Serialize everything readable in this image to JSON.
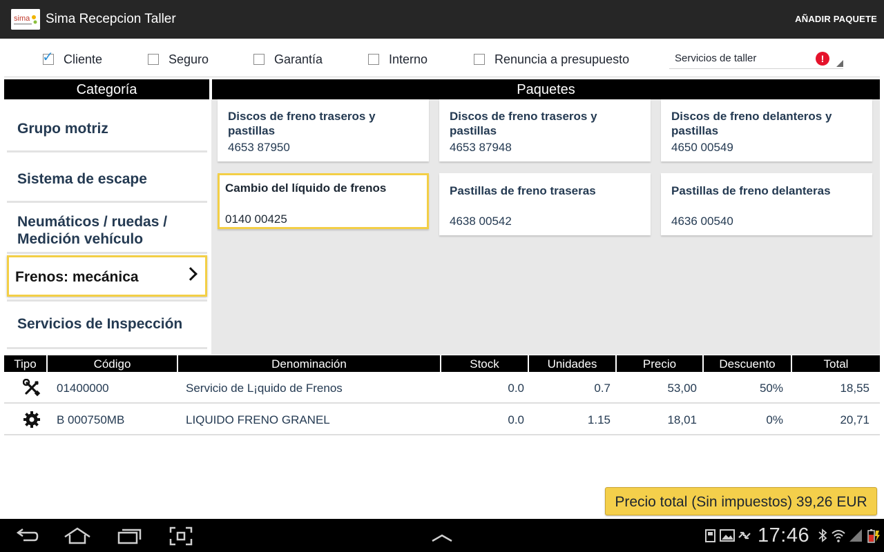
{
  "app": {
    "title": "Sima Recepcion Taller",
    "add_package_label": "AÑADIR PAQUETE"
  },
  "filters": {
    "checkboxes": [
      {
        "label": "Cliente",
        "checked": true
      },
      {
        "label": "Seguro",
        "checked": false
      },
      {
        "label": "Garantía",
        "checked": false
      },
      {
        "label": "Interno",
        "checked": false
      },
      {
        "label": "Renuncia a presupuesto",
        "checked": false
      }
    ],
    "service_select": {
      "value": "Servicios de taller",
      "alert": "!"
    }
  },
  "headers": {
    "category": "Categoría",
    "packages": "Paquetes"
  },
  "categories": [
    {
      "label": "Grupo motriz",
      "selected": false
    },
    {
      "label": "Sistema de escape",
      "selected": false
    },
    {
      "label": "Neumáticos / ruedas / Medición vehículo",
      "selected": false
    },
    {
      "label": "Frenos: mecánica",
      "selected": true
    },
    {
      "label": "Servicios de Inspección",
      "selected": false
    }
  ],
  "packages": [
    {
      "title": "Discos de freno traseros y pastillas",
      "code": "4653 87950",
      "selected": false
    },
    {
      "title": "Discos de freno traseros y pastillas",
      "code": "4653 87948",
      "selected": false
    },
    {
      "title": "Discos de freno delanteros y pastillas",
      "code": "4650 00549",
      "selected": false
    },
    {
      "title": "Cambio del líquido de frenos",
      "code": "0140 00425",
      "selected": true
    },
    {
      "title": "Pastillas de freno traseras",
      "code": "4638 00542",
      "selected": false
    },
    {
      "title": "Pastillas de freno delanteras",
      "code": "4636 00540",
      "selected": false
    }
  ],
  "table": {
    "columns": [
      "Tipo",
      "Código",
      "Denominación",
      "Stock",
      "Unidades",
      "Precio",
      "Descuento",
      "Total"
    ],
    "rows": [
      {
        "icon": "wrench-screwdriver-icon",
        "code": "01400000",
        "name": "Servicio de L¡quido de Frenos",
        "stock": "0.0",
        "units": "0.7",
        "price": "53,00",
        "discount": "50%",
        "total": "18,55"
      },
      {
        "icon": "gear-icon",
        "code": "B  000750MB",
        "name": "LIQUIDO FRENO GRANEL",
        "stock": "0.0",
        "units": "1.15",
        "price": "18,01",
        "discount": "0%",
        "total": "20,71"
      }
    ]
  },
  "total_button": "Precio total (Sin impuestos) 39,26 EUR",
  "status_bar": {
    "time": "17:46"
  },
  "colors": {
    "accent": "#f4cf4b",
    "text": "#243a52",
    "header_bg": "#000000",
    "actionbar_bg": "#262626",
    "panel_bg": "#e8e8e8",
    "alert": "#e5122b",
    "check": "#2d8fd5"
  }
}
